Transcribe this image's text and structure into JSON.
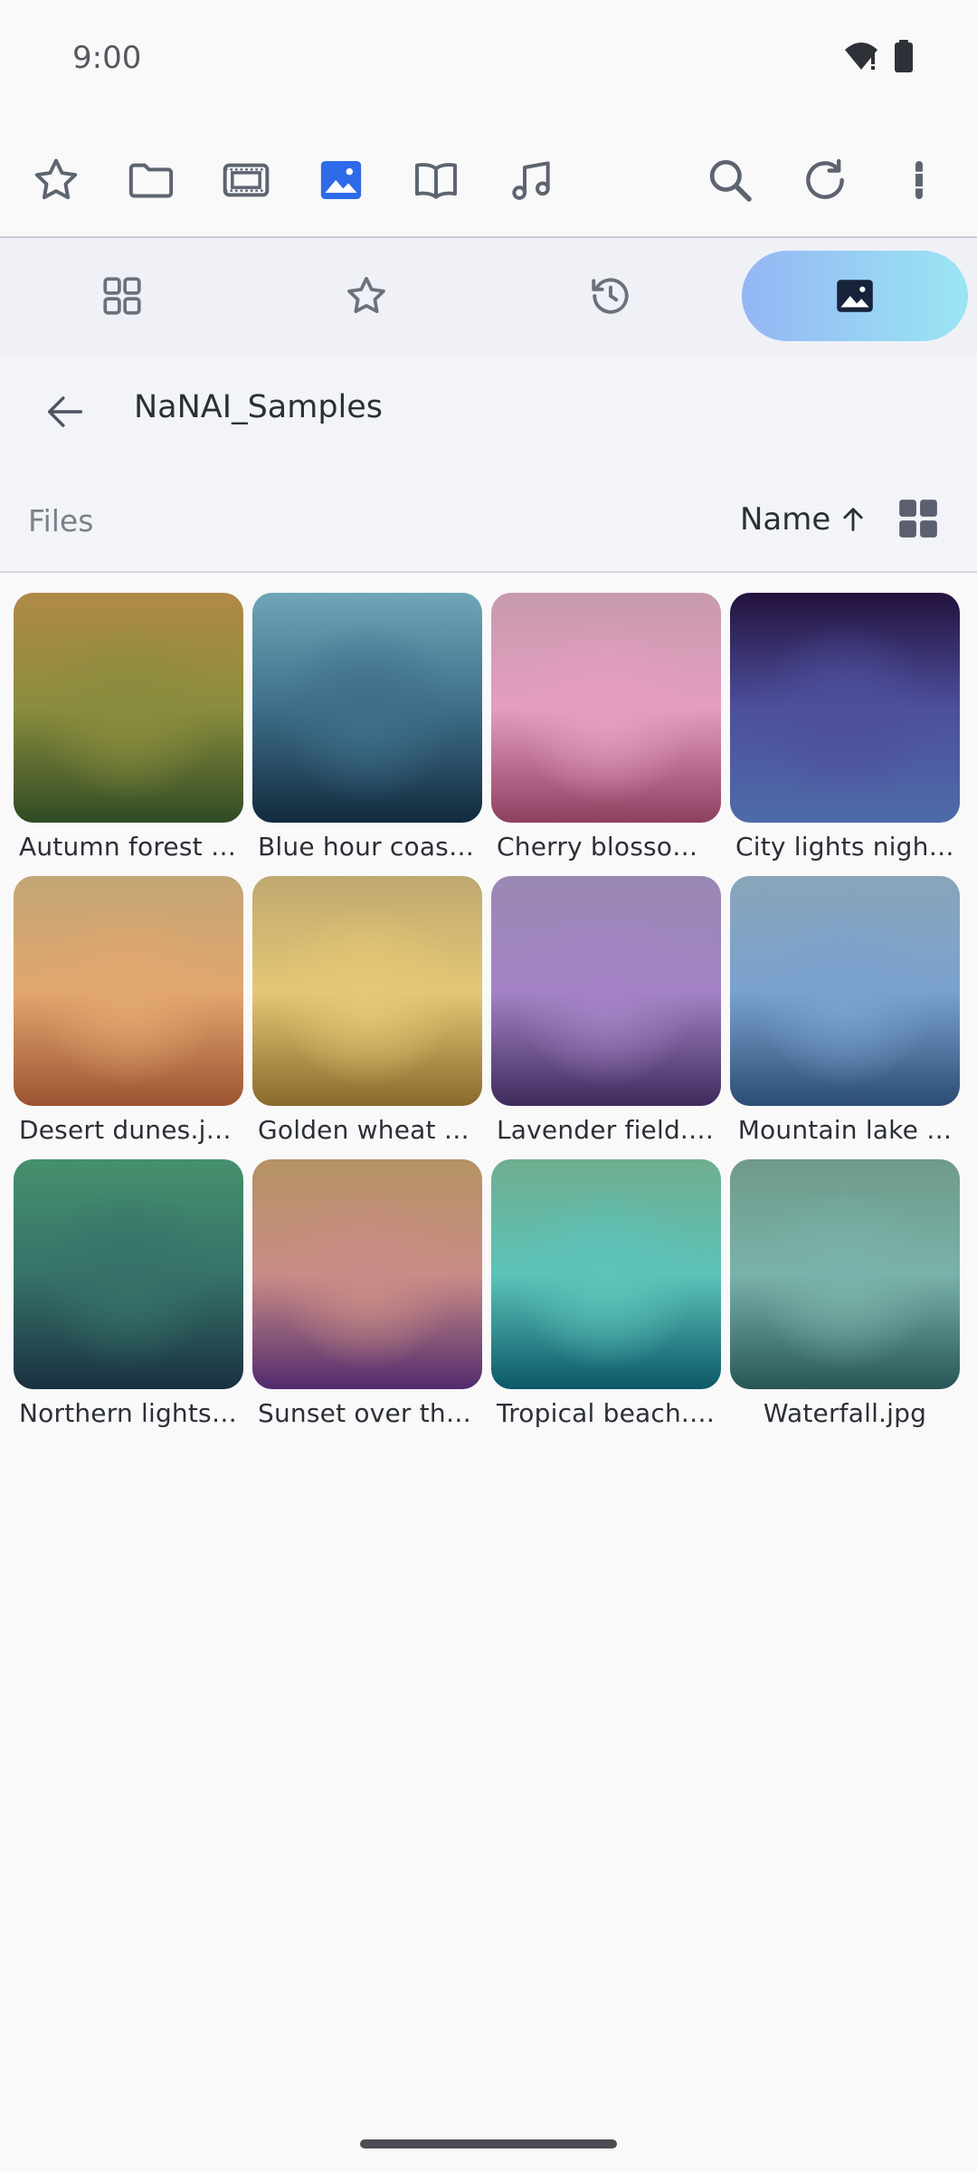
{
  "status": {
    "time": "9:00"
  },
  "toolbar": {
    "items": [
      {
        "icon": "star-outline-icon"
      },
      {
        "icon": "folder-icon"
      },
      {
        "icon": "video-icon"
      },
      {
        "icon": "image-icon",
        "active": true
      },
      {
        "icon": "book-icon"
      },
      {
        "icon": "music-note-icon"
      }
    ],
    "right": [
      {
        "icon": "search-icon"
      },
      {
        "icon": "refresh-icon"
      },
      {
        "icon": "more-vert-icon"
      }
    ]
  },
  "nav": {
    "tabs": [
      {
        "icon": "grid-icon"
      },
      {
        "icon": "star-outline-icon"
      },
      {
        "icon": "history-icon"
      },
      {
        "icon": "image-icon",
        "active": true
      }
    ]
  },
  "folder": {
    "title": "NaNAI_Samples"
  },
  "files": {
    "label": "Files",
    "sort_label": "Name",
    "sort_direction": "ascending"
  },
  "grid": {
    "items": [
      {
        "name": "Autumn forest t…",
        "colors": [
          "#b08a47",
          "#8a8c3d",
          "#2f4b24"
        ]
      },
      {
        "name": "Blue hour coastl…",
        "colors": [
          "#6ea6b8",
          "#3e6f8a",
          "#132a3d"
        ]
      },
      {
        "name": "Cherry blossom …",
        "colors": [
          "#c79aad",
          "#e59dc0",
          "#8e3f60"
        ]
      },
      {
        "name": "City lights night…",
        "colors": [
          "#23123d",
          "#4d4f9c",
          "#4e6ba8"
        ]
      },
      {
        "name": "Desert dunes.jpg",
        "colors": [
          "#c3a574",
          "#e2a66f",
          "#9c5432"
        ]
      },
      {
        "name": "Golden wheat fi…",
        "colors": [
          "#bea86f",
          "#e5c775",
          "#8a6a2c"
        ]
      },
      {
        "name": "Lavender field.jpg",
        "colors": [
          "#9a88b3",
          "#a383c5",
          "#3f2a5c"
        ]
      },
      {
        "name": "Mountain lake …",
        "colors": [
          "#8aa5b9",
          "#7aa2cf",
          "#2b4d74"
        ]
      },
      {
        "name": "Northern lights.…",
        "colors": [
          "#45906d",
          "#367269",
          "#1a3040"
        ]
      },
      {
        "name": "Sunset over the …",
        "colors": [
          "#b59263",
          "#c98c86",
          "#512a6d"
        ]
      },
      {
        "name": "Tropical beach.j…",
        "colors": [
          "#6fad8f",
          "#5cc3b9",
          "#0c5868"
        ]
      },
      {
        "name": "Waterfall.jpg",
        "colors": [
          "#6f9a89",
          "#79b2aa",
          "#285656"
        ]
      }
    ]
  }
}
